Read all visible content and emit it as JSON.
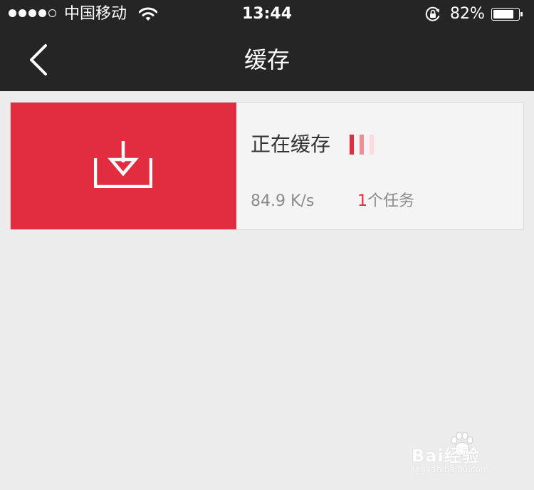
{
  "status_bar": {
    "carrier": "中国移动",
    "time": "13:44",
    "battery_percent": "82%",
    "battery_level": 0.82,
    "signal_bars_filled": 4,
    "signal_bars_total": 5
  },
  "nav": {
    "title": "缓存",
    "back_icon": "chevron-left-icon"
  },
  "cache_card": {
    "title": "正在缓存",
    "speed": "84.9 K/s",
    "task_count": "1",
    "task_label": "个任务",
    "icon": "download-tray-icon",
    "accent_color": "#e22d40",
    "progress_bar_colors": [
      "#e22d40",
      "#ef8d96",
      "#fbd9dc"
    ]
  },
  "watermark": {
    "brand": "Bai经验",
    "url": "jingyan.baidu.com"
  },
  "colors": {
    "bar_background": "#252525",
    "page_background": "#ececec",
    "card_background": "#f4f4f4"
  }
}
